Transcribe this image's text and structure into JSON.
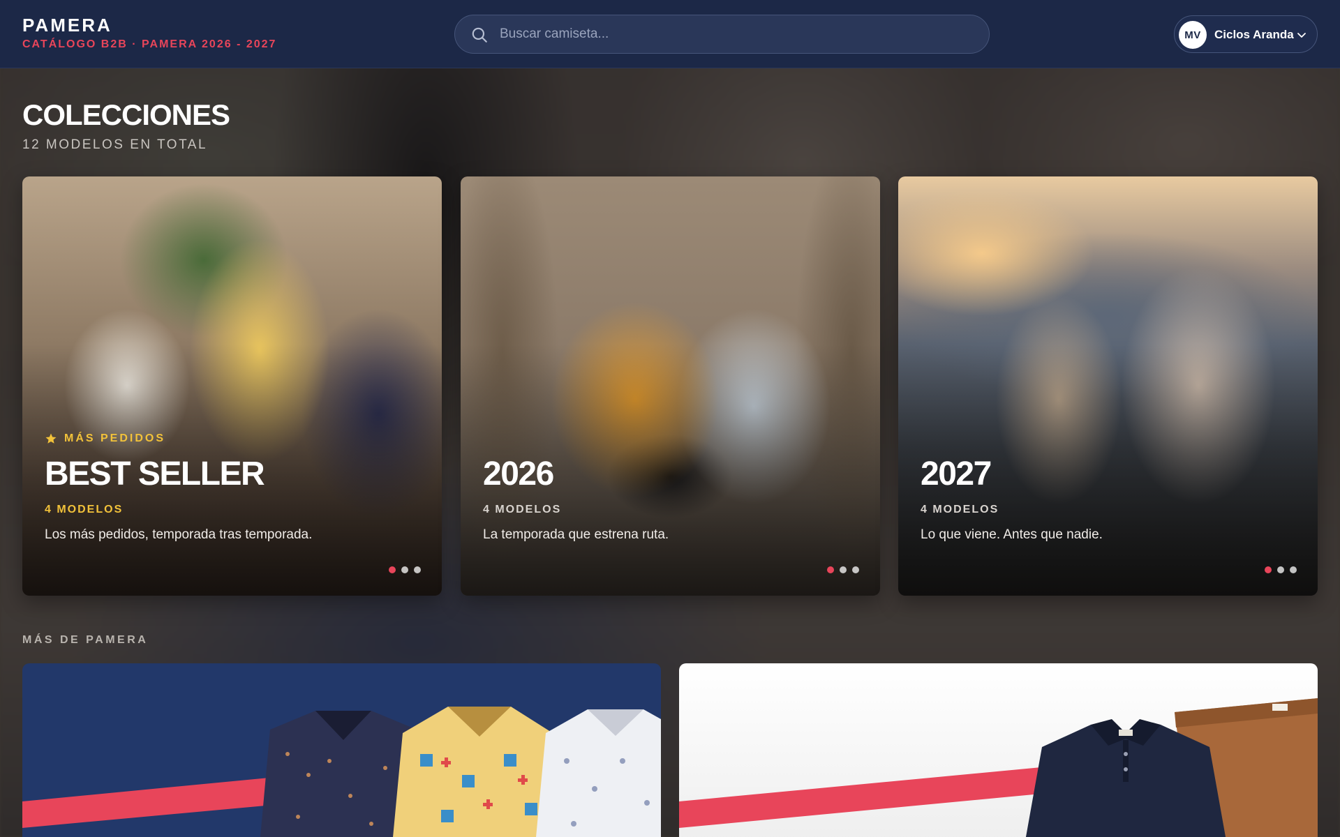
{
  "header": {
    "brand_name": "PAMERA",
    "brand_subtitle": "CATÁLOGO B2B · PAMERA 2026 - 2027",
    "search_placeholder": "Buscar camiseta...",
    "user_initials": "MV",
    "user_name": "Ciclos Aranda"
  },
  "collections": {
    "title": "COLECCIONES",
    "total": "12 MODELOS EN TOTAL",
    "cards": [
      {
        "eyebrow": "MÁS PEDIDOS",
        "title": "BEST SELLER",
        "count": "4 MODELOS",
        "description": "Los más pedidos, temporada tras temporada.",
        "slides": 3,
        "active_slide": 1
      },
      {
        "title": "2026",
        "count": "4 MODELOS",
        "description": "La temporada que estrena ruta.",
        "slides": 3,
        "active_slide": 1
      },
      {
        "title": "2027",
        "count": "4 MODELOS",
        "description": "Lo que viene. Antes que nadie.",
        "slides": 3,
        "active_slide": 1
      }
    ]
  },
  "more": {
    "label": "MÁS DE PAMERA"
  },
  "colors": {
    "header_bg": "#1c2847",
    "accent_red": "#e8455a",
    "accent_gold": "#f2c23a"
  },
  "icons": [
    "search-icon",
    "chevron-down-icon",
    "star-icon"
  ]
}
